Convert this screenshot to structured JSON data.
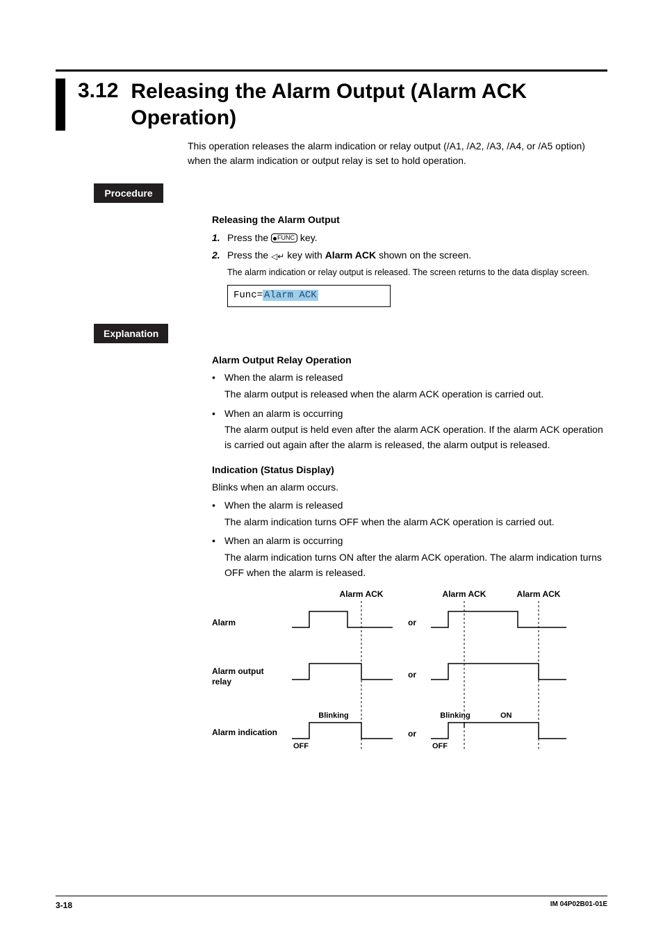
{
  "section": {
    "number": "3.12",
    "title": "Releasing the Alarm Output (Alarm ACK Operation)",
    "intro": "This operation releases the alarm indication or relay output (/A1, /A2, /A3, /A4, or /A5 option) when the alarm indication or output relay is set to hold operation."
  },
  "procedure": {
    "label": "Procedure",
    "heading": "Releasing the Alarm Output",
    "step1_a": "Press the ",
    "step1_key": "FUNC",
    "step1_b": " key.",
    "step2_a": "Press the ",
    "step2_b": " key with ",
    "step2_bold": "Alarm ACK",
    "step2_c": " shown on the screen.",
    "step2_note": "The alarm indication or relay output is released. The screen returns to the data display screen.",
    "screen_prefix": "Func=",
    "screen_value": "Alarm ACK"
  },
  "explanation": {
    "label": "Explanation",
    "h1": "Alarm Output Relay Operation",
    "b1_head": "When the alarm is released",
    "b1_body": "The alarm output is released when the alarm ACK operation is carried out.",
    "b2_head": "When an alarm is occurring",
    "b2_body": "The alarm output is held even after the alarm ACK operation. If the alarm ACK operation is carried out again after the alarm is released, the alarm output is released.",
    "h2": "Indication (Status Display)",
    "h2_sub": "Blinks when an alarm occurs.",
    "b3_head": "When the alarm is released",
    "b3_body": "The alarm indication turns OFF when the alarm ACK operation is carried out.",
    "b4_head": "When an alarm is occurring",
    "b4_body": "The alarm indication turns ON after the alarm ACK operation. The alarm indication turns OFF when the alarm is released."
  },
  "chart_data": {
    "type": "diagram",
    "title": "Alarm ACK timing diagram",
    "columns": [
      "Alarm ACK",
      "Alarm ACK",
      "Alarm ACK"
    ],
    "row_labels": [
      "Alarm",
      "Alarm output relay",
      "Alarm indication"
    ],
    "or_text": "or",
    "annotations": {
      "blinking": "Blinking",
      "on": "ON",
      "off": "OFF"
    },
    "description": "Three rows of step waveforms showing a pulse that goes high then low. Left group: single Alarm ACK marker at falling edge; pulse ends at ACK. Right group: two Alarm ACK markers — alarm output stays high through first ACK and drops at second; alarm indication: Blinking segment, then ON segment after first ACK, then OFF after second ACK."
  },
  "footer": {
    "page": "3-18",
    "doc": "IM 04P02B01-01E"
  }
}
